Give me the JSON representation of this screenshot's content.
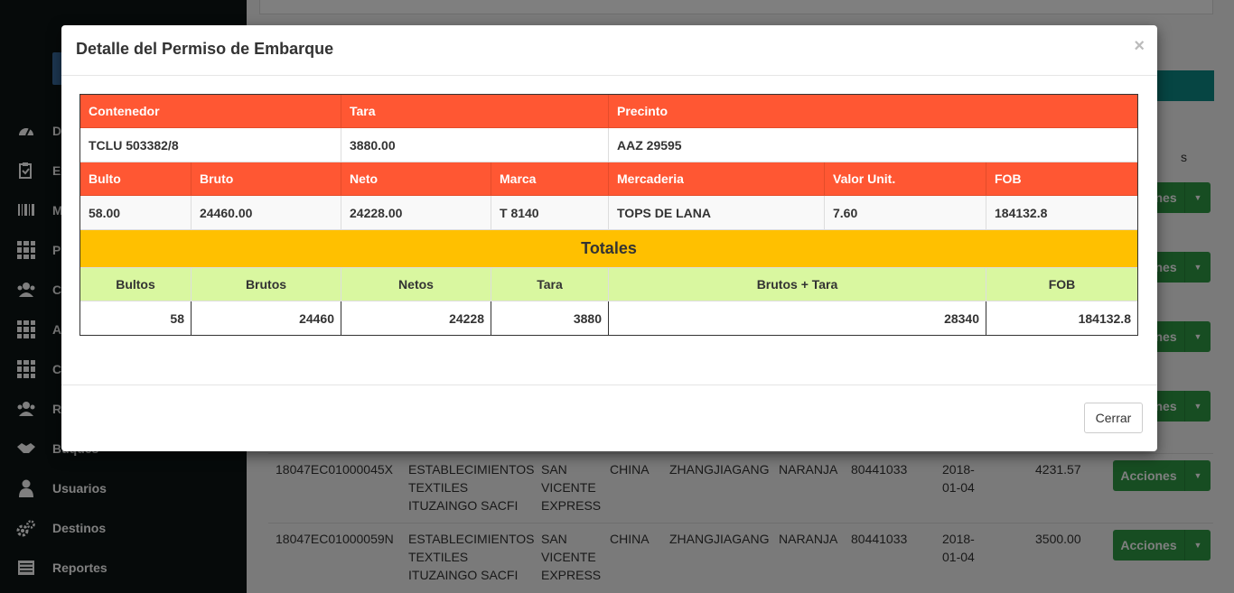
{
  "sidebar": {
    "items": [
      {
        "label": "Da",
        "icon": "dashboard-icon"
      },
      {
        "label": "Ex",
        "icon": "clipboard-icon"
      },
      {
        "label": "M",
        "icon": "barcode-icon"
      },
      {
        "label": "P",
        "icon": "grid-icon"
      },
      {
        "label": "C",
        "icon": "users-icon"
      },
      {
        "label": "A",
        "icon": "grid-icon"
      },
      {
        "label": "C",
        "icon": "grid-icon"
      },
      {
        "label": "R",
        "icon": "users-icon"
      },
      {
        "label": "Buques",
        "icon": "handshake-icon"
      },
      {
        "label": "Usuarios",
        "icon": "user-icon"
      },
      {
        "label": "Destinos",
        "icon": "gears-icon"
      },
      {
        "label": "Reportes",
        "icon": "list-icon"
      }
    ]
  },
  "background": {
    "fragment_s": "s",
    "action_label": "Acciones",
    "rows": [
      {
        "code": "18047EC01000045X",
        "exporter": "ESTABLECIMIENTOS TEXTILES ITUZAINGO SACFI",
        "ship": "SAN VICENTE EXPRESS",
        "country": "CHINA",
        "port": "ZHANGJIAGANG",
        "color": "NARANJA",
        "num": "80441033",
        "date": "2018-01-04",
        "amount": "4231.57"
      },
      {
        "code": "18047EC01000059N",
        "exporter": "ESTABLECIMIENTOS TEXTILES ITUZAINGO SACFI",
        "ship": "SAN VICENTE EXPRESS",
        "country": "CHINA",
        "port": "ZHANGJIAGANG",
        "color": "NARANJA",
        "num": "80441033",
        "date": "2018-01-04",
        "amount": "3500.00"
      }
    ]
  },
  "modal": {
    "title": "Detalle del Permiso de Embarque",
    "close_symbol": "×",
    "close_button": "Cerrar",
    "container_headers": [
      "Contenedor",
      "Tara",
      "Precinto"
    ],
    "container_values": [
      "TCLU 503382/8",
      "3880.00",
      "AAZ 29595"
    ],
    "item_headers": [
      "Bulto",
      "Bruto",
      "Neto",
      "Marca",
      "Mercaderia",
      "Valor Unit.",
      "FOB"
    ],
    "item_values": [
      "58.00",
      "24460.00",
      "24228.00",
      "T 8140",
      "TOPS DE LANA",
      "7.60",
      "184132.8"
    ],
    "totals_title": "Totales",
    "totals_headers": [
      "Bultos",
      "Brutos",
      "Netos",
      "Tara",
      "Brutos + Tara",
      "FOB"
    ],
    "totals_values": [
      "58",
      "24460",
      "24228",
      "3880",
      "28340",
      "184132.8"
    ]
  },
  "colors": {
    "header_orange": "#ff5733",
    "totals_yellow": "#ffc000",
    "totals_green": "#d9f7a0",
    "action_green": "#2e9b45"
  }
}
